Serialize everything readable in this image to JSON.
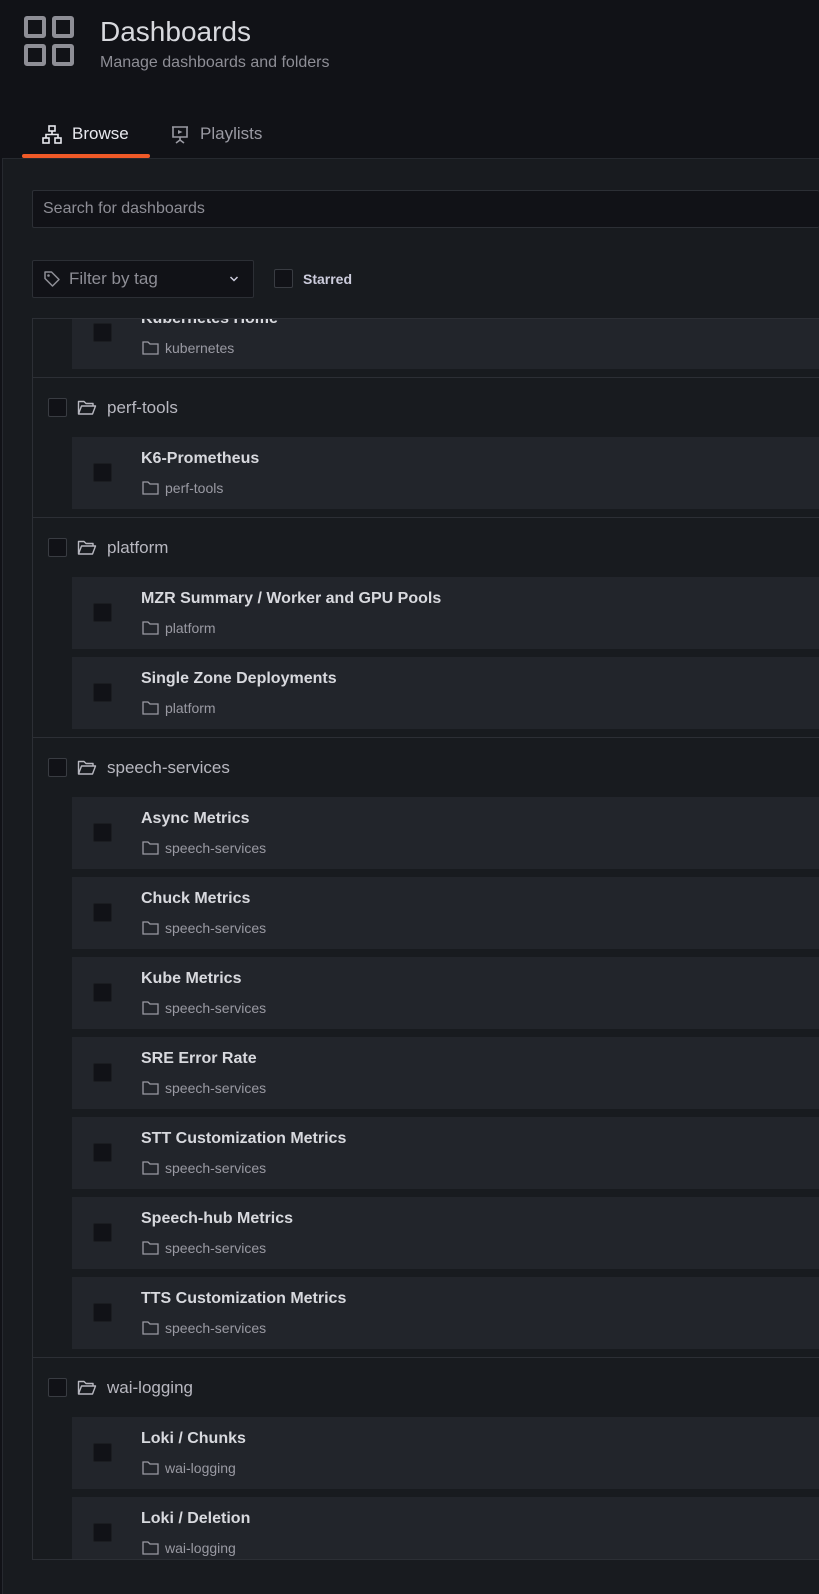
{
  "header": {
    "title": "Dashboards",
    "subtitle": "Manage dashboards and folders"
  },
  "tabs": [
    {
      "label": "Browse",
      "active": true,
      "icon": "sitemap-icon"
    },
    {
      "label": "Playlists",
      "active": false,
      "icon": "presentation-icon"
    }
  ],
  "search": {
    "placeholder": "Search for dashboards",
    "value": ""
  },
  "filters": {
    "tag_placeholder": "Filter by tag",
    "starred_label": "Starred",
    "starred_checked": false
  },
  "colors": {
    "accent": "#f05a28",
    "background": "#111217",
    "panel": "#181b1f",
    "row": "#22252b"
  },
  "list": {
    "partial_item": {
      "title": "Kubernetes Home",
      "folder": "kubernetes"
    },
    "folders": [
      {
        "name": "perf-tools",
        "items": [
          {
            "title": "K6-Prometheus",
            "folder": "perf-tools"
          }
        ]
      },
      {
        "name": "platform",
        "items": [
          {
            "title": "MZR Summary / Worker and GPU Pools",
            "folder": "platform"
          },
          {
            "title": "Single Zone Deployments",
            "folder": "platform"
          }
        ]
      },
      {
        "name": "speech-services",
        "items": [
          {
            "title": "Async Metrics",
            "folder": "speech-services"
          },
          {
            "title": "Chuck Metrics",
            "folder": "speech-services"
          },
          {
            "title": "Kube Metrics",
            "folder": "speech-services"
          },
          {
            "title": "SRE Error Rate",
            "folder": "speech-services"
          },
          {
            "title": "STT Customization Metrics",
            "folder": "speech-services"
          },
          {
            "title": "Speech-hub Metrics",
            "folder": "speech-services"
          },
          {
            "title": "TTS Customization Metrics",
            "folder": "speech-services"
          }
        ]
      },
      {
        "name": "wai-logging",
        "items": [
          {
            "title": "Loki / Chunks",
            "folder": "wai-logging"
          },
          {
            "title": "Loki / Deletion",
            "folder": "wai-logging"
          }
        ]
      }
    ]
  }
}
